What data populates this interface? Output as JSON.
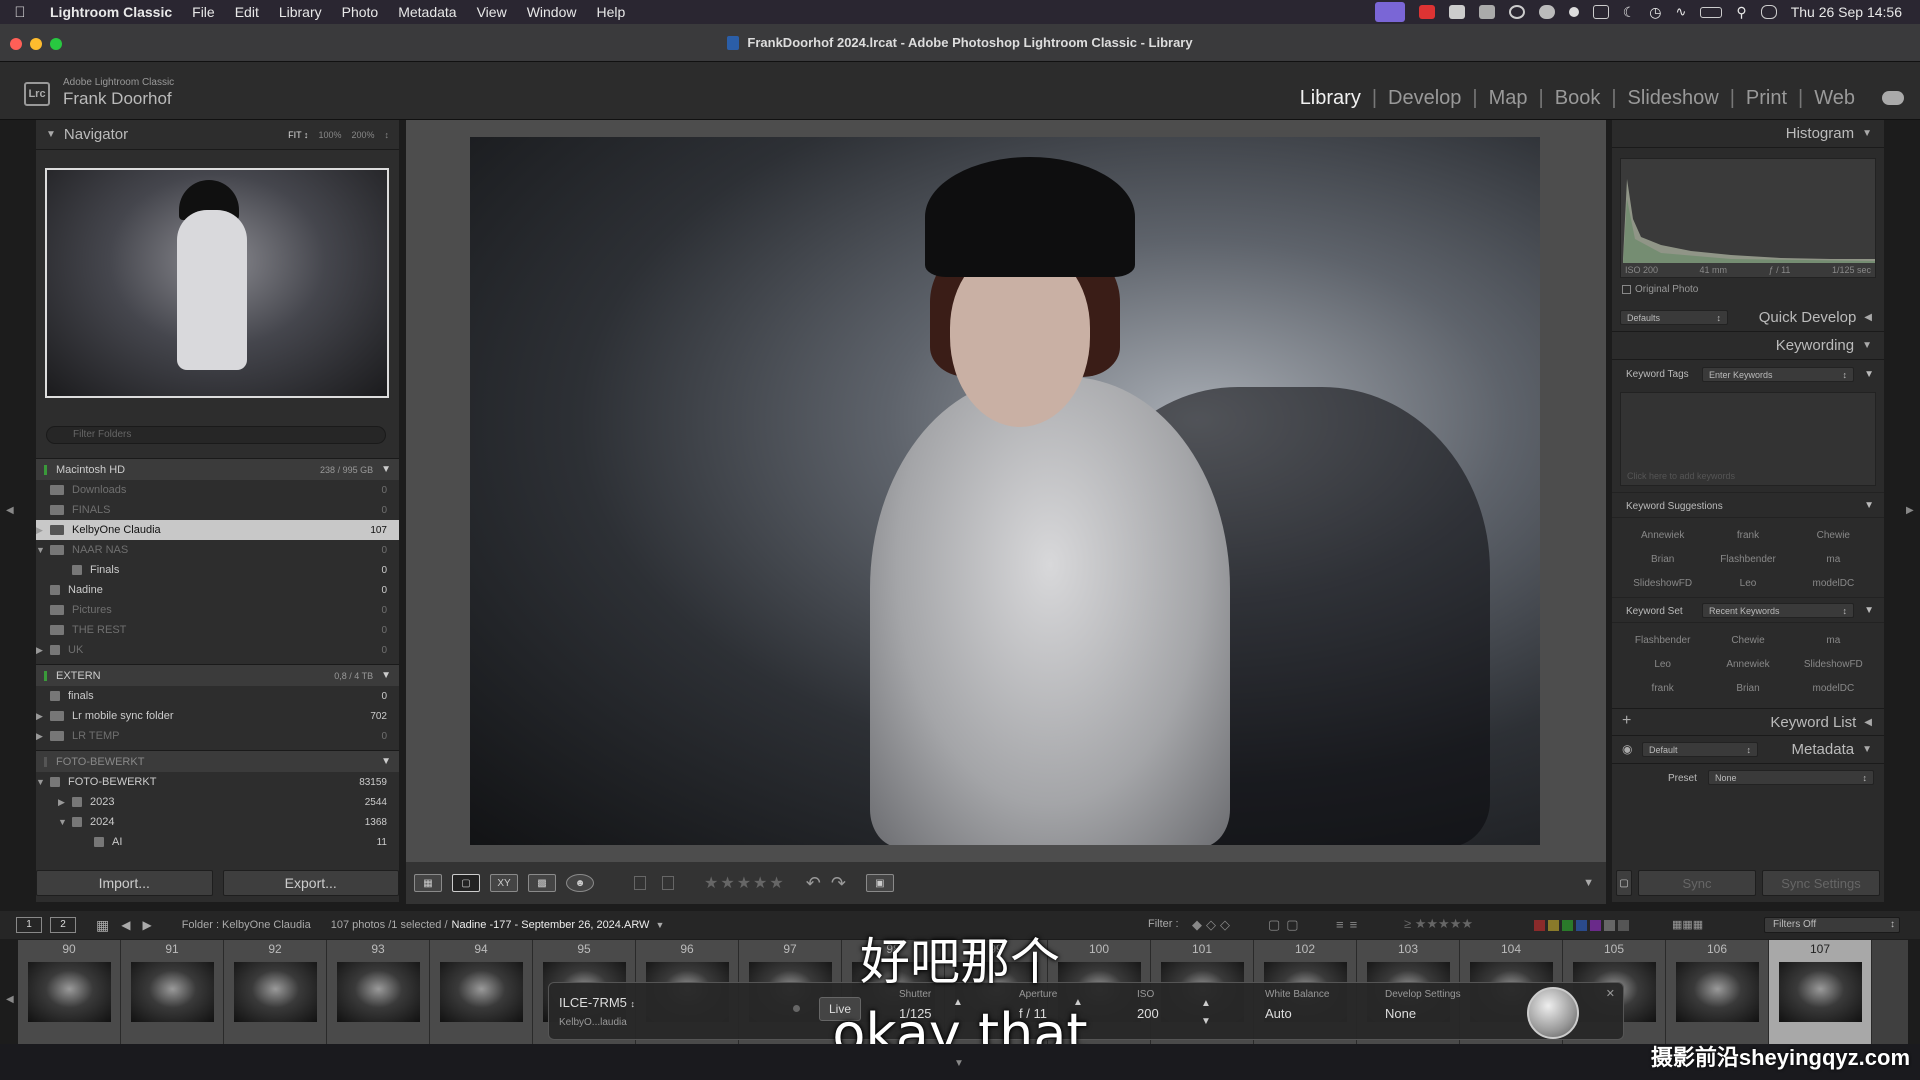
{
  "menubar": {
    "app": "Lightroom Classic",
    "items": [
      "File",
      "Edit",
      "Library",
      "Photo",
      "Metadata",
      "View",
      "Window",
      "Help"
    ],
    "clock": "Thu 26 Sep  14:56"
  },
  "window": {
    "title": "FrankDoorhof 2024.lrcat - Adobe Photoshop Lightroom Classic - Library"
  },
  "identity": {
    "logo": "Lrc",
    "product": "Adobe Lightroom Classic",
    "user": "Frank Doorhof"
  },
  "modules": [
    "Library",
    "Develop",
    "Map",
    "Book",
    "Slideshow",
    "Print",
    "Web"
  ],
  "active_module": "Library",
  "navigator": {
    "title": "Navigator",
    "zoom": [
      "FIT ↕",
      "100%",
      "200%",
      "↕"
    ]
  },
  "folders": {
    "filter_placeholder": "Filter Folders",
    "volumes": [
      {
        "name": "Macintosh HD",
        "capacity": "238 / 995 GB"
      },
      {
        "name": "EXTERN",
        "capacity": "0,8 / 4 TB"
      },
      {
        "name": "FOTO-BEWERKT",
        "capacity": ""
      }
    ],
    "mac_items": [
      {
        "name": "Downloads",
        "count": "0"
      },
      {
        "name": "FINALS",
        "count": "0"
      },
      {
        "name": "KelbyOne Claudia",
        "count": "107"
      },
      {
        "name": "NAAR NAS",
        "count": "0"
      },
      {
        "name": "Finals",
        "count": "0"
      },
      {
        "name": "Nadine",
        "count": "0"
      },
      {
        "name": "Pictures",
        "count": "0"
      },
      {
        "name": "THE REST",
        "count": "0"
      },
      {
        "name": "UK",
        "count": "0"
      }
    ],
    "extern_items": [
      {
        "name": "finals",
        "count": "0"
      },
      {
        "name": "Lr mobile sync folder",
        "count": "702"
      },
      {
        "name": "LR TEMP",
        "count": "0"
      }
    ],
    "foto_items": [
      {
        "name": "FOTO-BEWERKT",
        "count": "83159"
      },
      {
        "name": "2023",
        "count": "2544"
      },
      {
        "name": "2024",
        "count": "1368"
      },
      {
        "name": "AI",
        "count": "11"
      }
    ]
  },
  "buttons": {
    "import": "Import...",
    "export": "Export...",
    "sync": "Sync",
    "sync_settings": "Sync Settings"
  },
  "histogram": {
    "title": "Histogram",
    "iso": "ISO 200",
    "focal": "41 mm",
    "aperture": "ƒ / 11",
    "shutter": "1/125 sec",
    "original_photo": "Original Photo"
  },
  "quick_develop": {
    "title": "Quick Develop",
    "preset": "Defaults"
  },
  "keywording": {
    "title": "Keywording",
    "tags_label": "Keyword Tags",
    "tags_value": "Enter Keywords",
    "add_placeholder": "Click here to add keywords",
    "suggestions_label": "Keyword Suggestions",
    "suggestions": [
      "Annewiek",
      "frank",
      "Chewie",
      "Brian",
      "Flashbender",
      "ma",
      "SlideshowFD",
      "Leo",
      "modelDC"
    ],
    "set_label": "Keyword Set",
    "set_value": "Recent Keywords",
    "set_keywords": [
      "Flashbender",
      "Chewie",
      "ma",
      "Leo",
      "Annewiek",
      "SlideshowFD",
      "frank",
      "Brian",
      "modelDC"
    ]
  },
  "keyword_list": {
    "title": "Keyword List"
  },
  "metadata": {
    "title": "Metadata",
    "preset_label": "Preset",
    "preset_value": "None",
    "default": "Default"
  },
  "filmstrip_bar": {
    "screens": [
      "1",
      "2"
    ],
    "folder": "Folder : KelbyOne Claudia",
    "counts": "107 photos /1 selected /",
    "filename": "Nadine  -177 - September 26, 2024.ARW",
    "filter_label": "Filter :",
    "filters_off": "Filters Off"
  },
  "filmstrip": {
    "numbers": [
      "90",
      "91",
      "92",
      "93",
      "94",
      "95",
      "96",
      "97",
      "98",
      "99",
      "100",
      "101",
      "102",
      "103",
      "104",
      "105",
      "106",
      "107"
    ],
    "selected": "107"
  },
  "tether": {
    "camera": "ILCE-7RM5",
    "session": "KelbyO...laudia",
    "live": "Live",
    "shutter_label": "Shutter",
    "shutter": "1/125",
    "aperture_label": "Aperture",
    "aperture": "f / 11",
    "iso_label": "ISO",
    "iso": "200",
    "wb_label": "White Balance",
    "wb": "Auto",
    "dev_label": "Develop Settings",
    "dev": "None"
  },
  "subtitles": {
    "cn": "好吧那个",
    "en": "okay that"
  },
  "watermark": "摄影前沿sheyingqyz.com"
}
